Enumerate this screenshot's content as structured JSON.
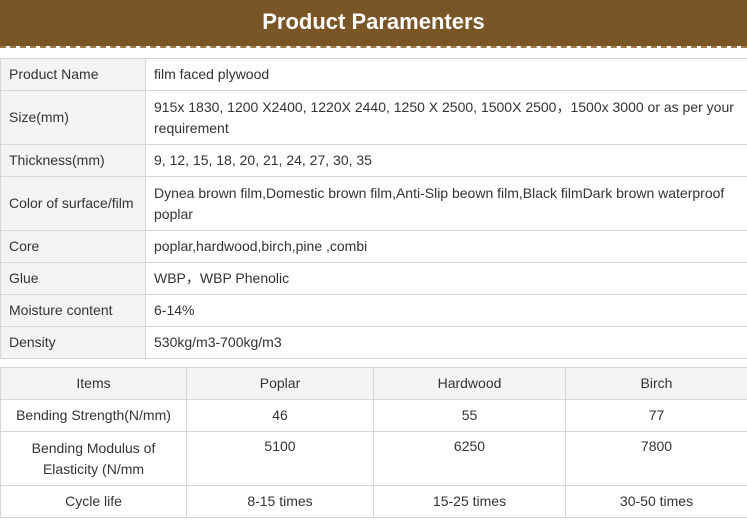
{
  "banner": {
    "title": "Product Paramenters",
    "color": "#7a5526"
  },
  "specs": [
    {
      "label": "Product Name",
      "value": "film faced plywood"
    },
    {
      "label": "Size(mm)",
      "value": "915x 1830, 1200 X2400, 1220X 2440, 1250 X 2500, 1500X 2500，1500x 3000 or as per your requirement"
    },
    {
      "label": "Thickness(mm)",
      "value": "9, 12, 15, 18, 20, 21, 24, 27, 30, 35"
    },
    {
      "label": "Color of surface/film",
      "value": "Dynea brown film,Domestic brown film,Anti-Slip beown film,Black filmDark brown waterproof poplar"
    },
    {
      "label": "Core",
      "value": "poplar,hardwood,birch,pine ,combi"
    },
    {
      "label": "Glue",
      "value": "WBP，WBP Phenolic"
    },
    {
      "label": "Moisture content",
      "value": "6-14%"
    },
    {
      "label": "Density",
      "value": "530kg/m3-700kg/m3"
    }
  ],
  "comparison": {
    "headers": [
      "Items",
      "Poplar",
      "Hardwood",
      "Birch"
    ],
    "rows": [
      [
        "Bending Strength(N/mm)",
        "46",
        "55",
        "77"
      ],
      [
        "Bending Modulus of Elasticity (N/mm",
        "5100",
        "6250",
        "7800"
      ],
      [
        "Cycle life",
        "8-15 times",
        "15-25 times",
        "30-50 times"
      ]
    ]
  }
}
